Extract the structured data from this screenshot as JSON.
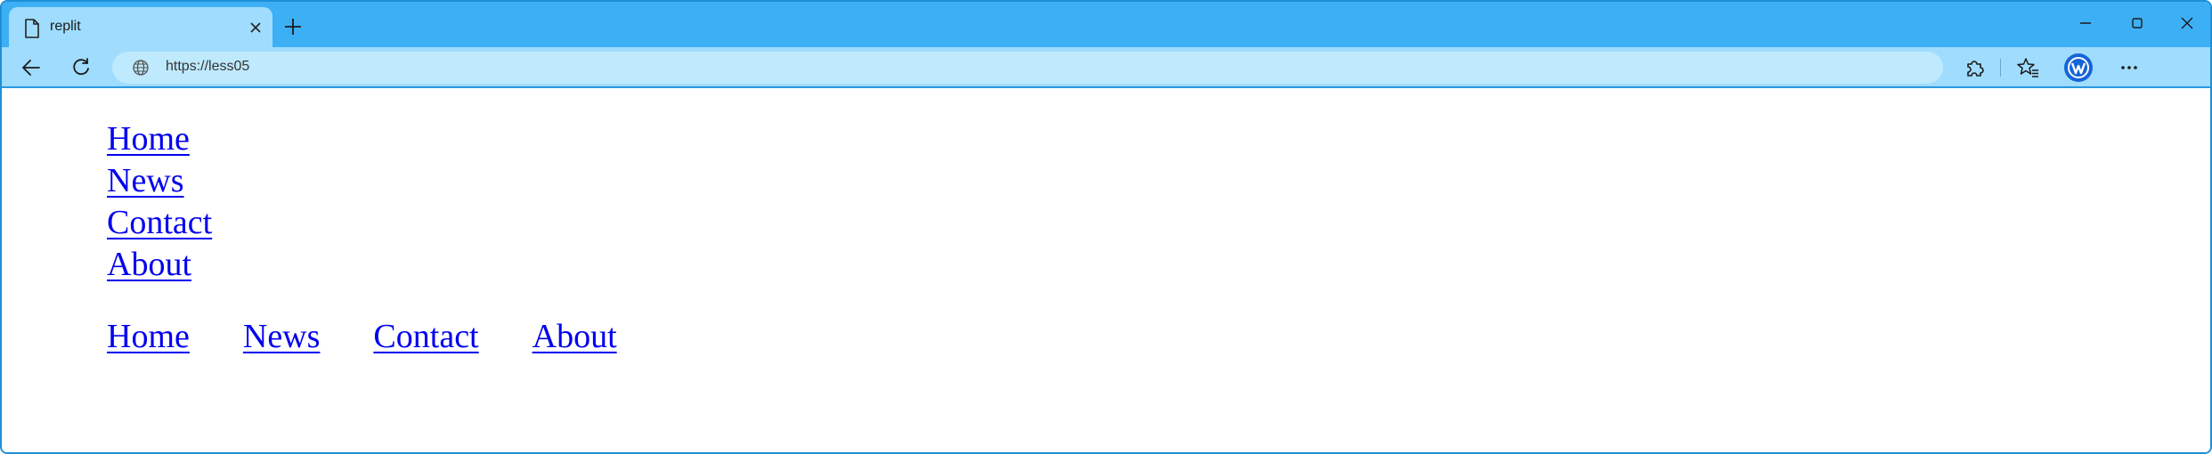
{
  "browser": {
    "tab_title": "replit",
    "address_url": "https://less05",
    "icons": {
      "tab": "page-icon",
      "close": "close-icon",
      "new_tab": "plus-icon",
      "back": "back-arrow-icon",
      "reload": "reload-icon",
      "site": "globe-icon",
      "extensions": "puzzle-icon",
      "favorites": "favorites-icon",
      "profile": "profile-avatar-icon",
      "more": "more-icon"
    },
    "colors": {
      "tab_strip": "#3db0f5",
      "toolbar": "#9fdcfd",
      "address_bar": "#bfe9fd",
      "profile": "#1565d8"
    }
  },
  "page": {
    "vertical_nav": [
      "Home",
      "News",
      "Contact",
      "About"
    ],
    "horizontal_nav": [
      "Home",
      "News",
      "Contact",
      "About"
    ],
    "link_color": "#0000ee"
  }
}
